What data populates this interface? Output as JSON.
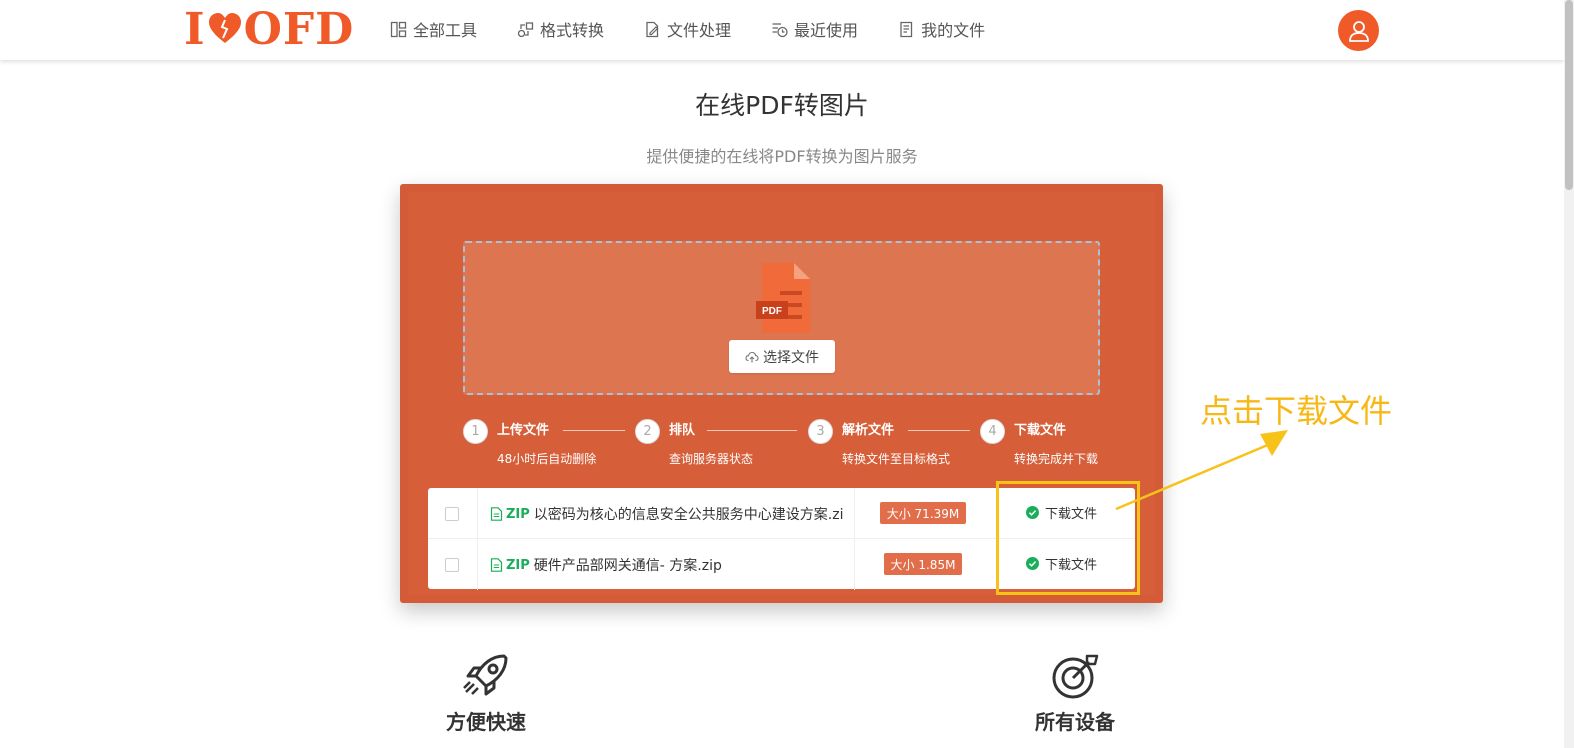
{
  "header": {
    "logo_text_left": "I",
    "logo_text_right": "OFD",
    "nav": [
      {
        "label": "全部工具",
        "icon": "grid-icon"
      },
      {
        "label": "格式转换",
        "icon": "convert-icon"
      },
      {
        "label": "文件处理",
        "icon": "file-edit-icon"
      },
      {
        "label": "最近使用",
        "icon": "recent-icon"
      },
      {
        "label": "我的文件",
        "icon": "my-files-icon"
      }
    ],
    "avatar_icon": "user-icon"
  },
  "page": {
    "title": "在线PDF转图片",
    "subtitle": "提供便捷的在线将PDF转换为图片服务"
  },
  "converter": {
    "pdf_icon_label": "PDF",
    "select_button_label": "选择文件",
    "steps": [
      {
        "num": "1",
        "title": "上传文件",
        "desc": "48小时后自动删除"
      },
      {
        "num": "2",
        "title": "排队",
        "desc": "查询服务器状态"
      },
      {
        "num": "3",
        "title": "解析文件",
        "desc": "转换文件至目标格式"
      },
      {
        "num": "4",
        "title": "下载文件",
        "desc": "转换完成并下载"
      }
    ],
    "files": [
      {
        "ext": "ZIP",
        "name": "以密码为核心的信息安全公共服务中心建设方案.zi",
        "size": "大小 71.39M",
        "action": "下载文件"
      },
      {
        "ext": "ZIP",
        "name": "硬件产品部网关通信- 方案.zip",
        "size": "大小 1.85M",
        "action": "下载文件"
      }
    ]
  },
  "annotation": {
    "callout": "点击下载文件",
    "color": "#f7b816"
  },
  "features": [
    {
      "label": "方便快速",
      "icon": "rocket-icon"
    },
    {
      "label": "所有设备",
      "icon": "target-icon"
    }
  ],
  "colors": {
    "brand": "#f05a28",
    "panel": "#d45b37",
    "success": "#1aad5a"
  }
}
